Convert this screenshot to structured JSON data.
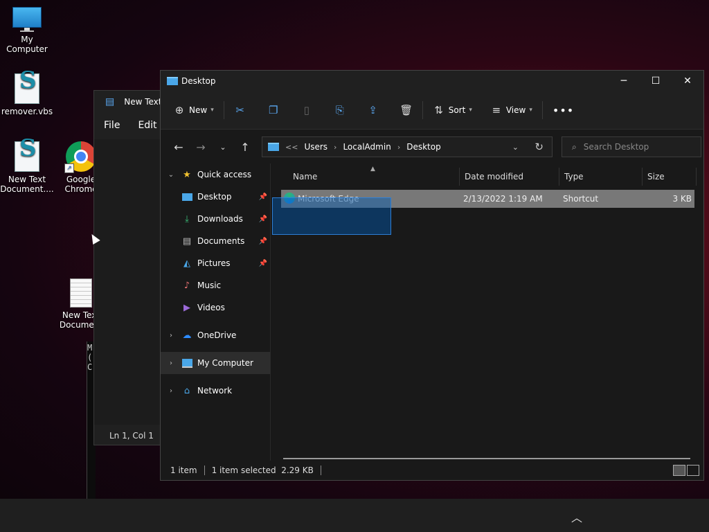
{
  "desktop": {
    "icons": [
      {
        "label": "My Computer"
      },
      {
        "label": "remover.vbs"
      },
      {
        "label": "New Text Document...."
      },
      {
        "label": "Google Chrome"
      },
      {
        "label": "New Text Document"
      }
    ]
  },
  "notepad": {
    "title": "New Text",
    "menu": [
      "File",
      "Edit"
    ],
    "status": "Ln 1, Col 1"
  },
  "console": {
    "lines": [
      "M",
      "(",
      "C"
    ]
  },
  "explorer": {
    "title": "Desktop",
    "toolbar": {
      "new_label": "New",
      "sort_label": "Sort",
      "view_label": "View"
    },
    "address": {
      "sep": "<<",
      "crumbs": [
        "Users",
        "LocalAdmin",
        "Desktop"
      ]
    },
    "search_placeholder": "Search Desktop",
    "nav": {
      "quick_access": "Quick access",
      "pinned": [
        "Desktop",
        "Downloads",
        "Documents",
        "Pictures"
      ],
      "others": [
        "Music",
        "Videos"
      ],
      "onedrive": "OneDrive",
      "mycomputer": "My Computer",
      "network": "Network"
    },
    "columns": {
      "name": "Name",
      "date": "Date modified",
      "type": "Type",
      "size": "Size"
    },
    "files": [
      {
        "name": "Microsoft Edge",
        "date": "2/13/2022 1:19 AM",
        "type": "Shortcut",
        "size": "3 KB"
      }
    ],
    "status": {
      "count": "1 item",
      "selected": "1 item selected  2.29 KB"
    }
  },
  "colors": {
    "accent": "#2d7fd6",
    "selected_row": "#787878",
    "window_bg": "#191919"
  }
}
